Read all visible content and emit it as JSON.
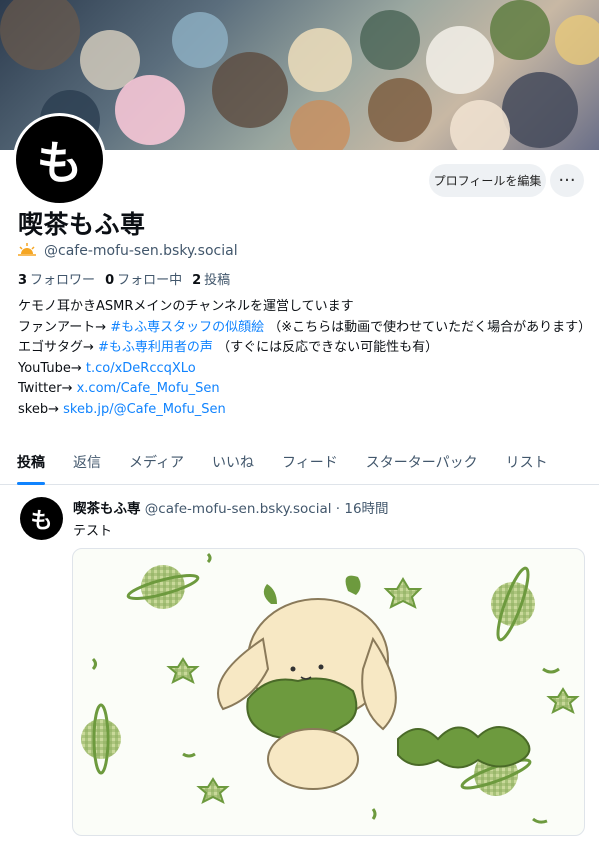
{
  "profile": {
    "display_name": "喫茶もふ専",
    "avatar_glyph": "も",
    "handle": "@cafe-mofu-sen.bsky.social",
    "handle_icon": "sun-icon",
    "edit_button": "プロフィールを編集",
    "more_button": "···",
    "stats": {
      "followers_count": "3",
      "followers_label": "フォロワー",
      "following_count": "0",
      "following_label": "フォロー中",
      "posts_count": "2",
      "posts_label": "投稿"
    },
    "bio": {
      "line1": "ケモノ耳かきASMRメインのチャンネルを運営しています",
      "line2_prefix": "ファンアート→ ",
      "line2_link": "#もふ専スタッフの似顔絵",
      "line2_suffix": " （※こちらは動画で使わせていただく場合があります）",
      "line3_prefix": "エゴサタグ→ ",
      "line3_link": "#もふ専利用者の声",
      "line3_suffix": " （すぐには反応できない可能性も有）",
      "line4_prefix": "YouTube→ ",
      "line4_link": "t.co/xDeRccqXLo",
      "line5_prefix": "Twitter→ ",
      "line5_link": "x.com/Cafe_Mofu_Sen",
      "line6_prefix": "skeb→ ",
      "line6_link": "skeb.jp/@Cafe_Mofu_Sen"
    }
  },
  "tabs": [
    {
      "label": "投稿",
      "active": true
    },
    {
      "label": "返信"
    },
    {
      "label": "メディア"
    },
    {
      "label": "いいね"
    },
    {
      "label": "フィード"
    },
    {
      "label": "スターターパック"
    },
    {
      "label": "リスト"
    }
  ],
  "post": {
    "author": "喫茶もふ専",
    "handle": "@cafe-mofu-sen.bsky.social",
    "separator": "·",
    "time": "16時間",
    "text": "テスト"
  },
  "colors": {
    "accent": "#1083fe",
    "muted": "#42576c"
  }
}
